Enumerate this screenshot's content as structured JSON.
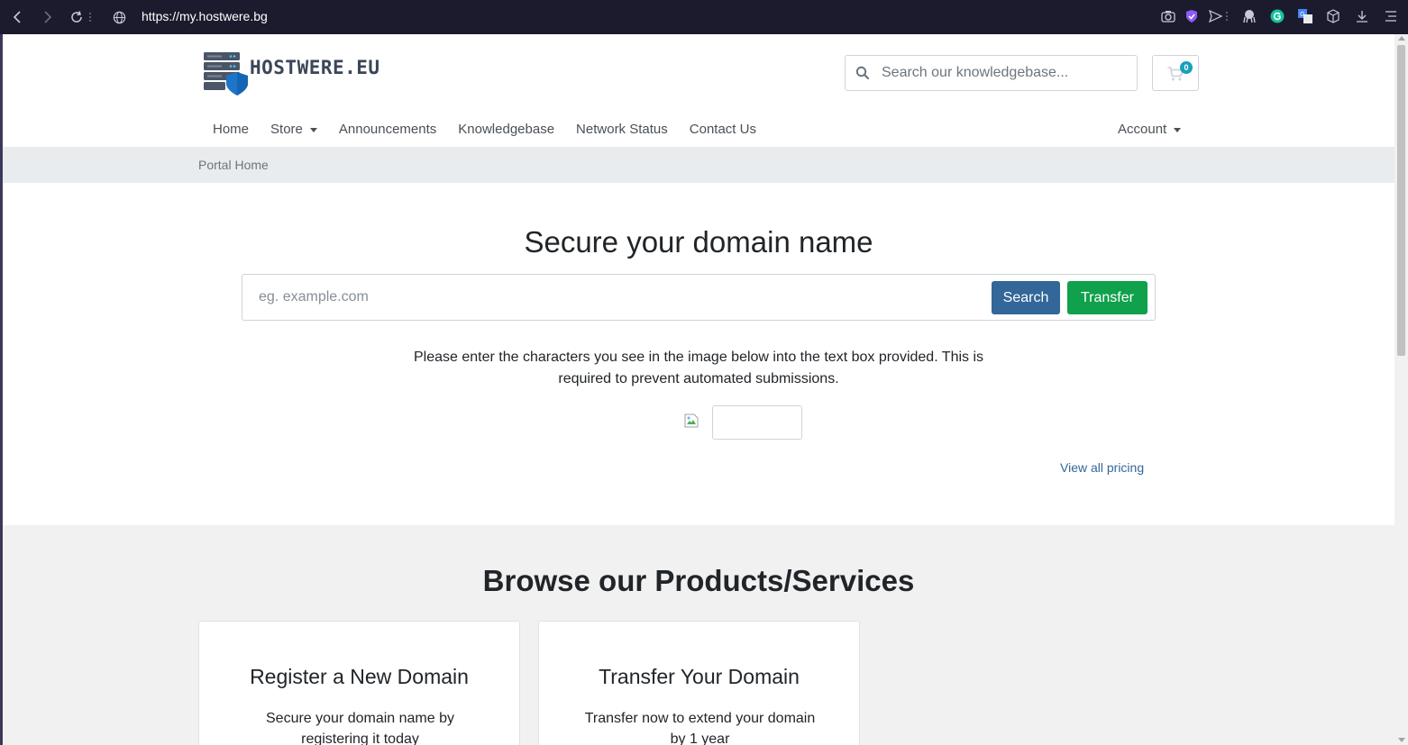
{
  "browser": {
    "url": "https://my.hostwere.bg",
    "icons": [
      "camera-icon",
      "shield-check-icon",
      "send-icon",
      "octopus-icon",
      "grammarly-icon",
      "translate-icon",
      "box-icon",
      "download-icon",
      "menu-icon"
    ]
  },
  "header": {
    "logo_text": "HOSTWERE.EU",
    "search_placeholder": "Search our knowledgebase...",
    "cart_count": "0"
  },
  "nav": {
    "items": [
      {
        "label": "Home"
      },
      {
        "label": "Store"
      },
      {
        "label": "Announcements"
      },
      {
        "label": "Knowledgebase"
      },
      {
        "label": "Network Status"
      },
      {
        "label": "Contact Us"
      }
    ],
    "account_label": "Account"
  },
  "breadcrumb": {
    "label": "Portal Home"
  },
  "domain": {
    "title": "Secure your domain name",
    "placeholder": "eg. example.com",
    "search_label": "Search",
    "transfer_label": "Transfer",
    "captcha_text": "Please enter the characters you see in the image below into the text box provided. This is required to prevent automated submissions.",
    "view_pricing": "View all pricing"
  },
  "browse": {
    "title": "Browse our Products/Services",
    "cards": [
      {
        "title": "Register a New Domain",
        "text": "Secure your domain name by registering it today"
      },
      {
        "title": "Transfer Your Domain",
        "text": "Transfer now to extend your domain by 1 year"
      }
    ]
  },
  "colors": {
    "primary": "#336699",
    "success": "#0fa14b",
    "badge": "#17a2b8",
    "browser_bar": "#1c1b2e"
  }
}
